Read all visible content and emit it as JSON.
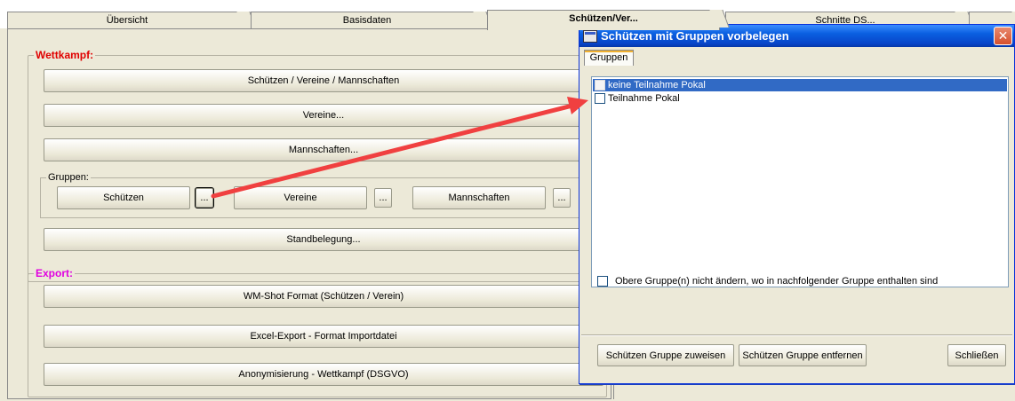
{
  "tabs": [
    {
      "label": "Übersicht"
    },
    {
      "label": "Basisdaten"
    },
    {
      "label": "Schützen/Ver..."
    },
    {
      "label": "Schnitte DS..."
    }
  ],
  "wettkampf": {
    "legend": "Wettkampf:",
    "legend_color": "#e00000",
    "btn_schuetzen_vereine": "Schützen / Vereine / Mannschaften",
    "btn_vereine": "Vereine...",
    "btn_mannschaften": "Mannschaften...",
    "gruppen": {
      "legend": "Gruppen:",
      "schuetzen": "Schützen",
      "vereine": "Vereine",
      "mannschaften": "Mannschaften",
      "dots": "..."
    },
    "btn_standbelegung": "Standbelegung..."
  },
  "export": {
    "legend": "Export:",
    "legend_color": "#e000e0",
    "btn_wmshot": "WM-Shot Format (Schützen / Verein)",
    "btn_excel": "Excel-Export - Format Importdatei",
    "btn_anonym": "Anonymisierung - Wettkampf (DSGVO)"
  },
  "dialog": {
    "title": "Schützen mit Gruppen vorbelegen",
    "close_glyph": "✕",
    "tab": "Gruppen",
    "items": [
      {
        "label": "keine Teilnahme Pokal",
        "selected": true
      },
      {
        "label": "Teilnahme Pokal",
        "selected": false
      }
    ],
    "option_label": "Obere Gruppe(n) nicht ändern, wo in nachfolgender Gruppe enthalten sind",
    "btn_assign": "Schützen Gruppe zuweisen",
    "btn_remove": "Schützen Gruppe entfernen",
    "btn_close": "Schließen"
  },
  "annotation": {
    "arrow_color": "#f04040"
  }
}
